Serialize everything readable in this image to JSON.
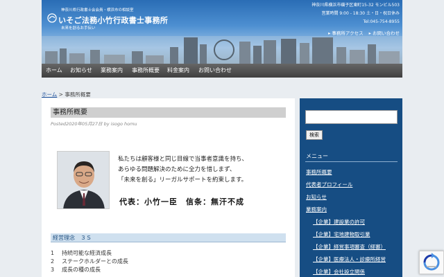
{
  "header": {
    "association": "神奈川県行政書士会会員・横浜市の相談室",
    "site_title": "いそご法務小竹行政書士事務所",
    "tagline": "未来を創るお手伝い",
    "address": "神奈川県横浜市磯子区東町15-32 モンビル503",
    "hours": "営業時間 9:00 - 18:30 土・日・祝日休み",
    "tel": "Tel:045-754-8955",
    "link_access": "▸ 事務所アクセス",
    "link_contact": "▸ お問い合わせ"
  },
  "nav": {
    "items": [
      "ホーム",
      "お知らせ",
      "業務案内",
      "事務所概要",
      "料金案内",
      "お問い合わせ"
    ]
  },
  "breadcrumb": {
    "home": "ホーム",
    "separator": " > ",
    "current": "事務所概要"
  },
  "article": {
    "title": "事務所概要",
    "meta": "Posted2020年05月27日  by  isogo homu",
    "intro_lines": [
      "私たちは顧客様と同じ目線で当事者意識を持ち、",
      "あらゆる問題解決のために全力を惜しまず、",
      "「未来を創る」リーガルサポートを約束します。"
    ],
    "signature": "代表：小竹一臣　信条：無汗不成",
    "section_heading": "経営理念　３Ｓ",
    "principles": [
      {
        "num": "1",
        "text": "持続可能な経済成長"
      },
      {
        "num": "2",
        "text": "ステークホルダーとの成長"
      },
      {
        "num": "3",
        "text": "成長の種の成長"
      }
    ]
  },
  "sidebar": {
    "search_button": "検索",
    "menu_title": "メニュー",
    "menu_items": [
      "事務所概要",
      "代表者プロフィール",
      "お知らせ",
      "業務案内",
      "【企業】建設業の許可",
      "【企業】宅地建物取引業",
      "【企業】経営事項審査（経審）",
      "【企業】医療法人・診療所経営",
      "【企業】会社設立関係"
    ]
  },
  "colors": {
    "header_blue": "#2a6db5",
    "nav_dark": "#4a4a4a",
    "sidebar_blue": "#164d83",
    "section_band": "#cfe0ef"
  }
}
